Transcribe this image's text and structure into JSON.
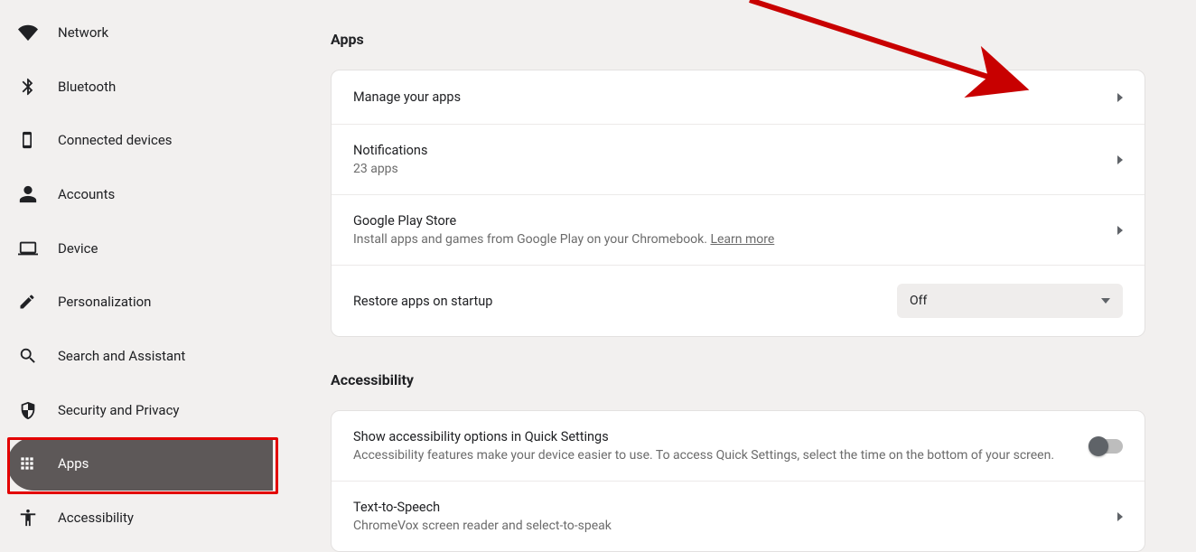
{
  "sidebar": {
    "items": [
      {
        "label": "Network"
      },
      {
        "label": "Bluetooth"
      },
      {
        "label": "Connected devices"
      },
      {
        "label": "Accounts"
      },
      {
        "label": "Device"
      },
      {
        "label": "Personalization"
      },
      {
        "label": "Search and Assistant"
      },
      {
        "label": "Security and Privacy"
      },
      {
        "label": "Apps"
      },
      {
        "label": "Accessibility"
      }
    ]
  },
  "sections": {
    "apps": {
      "title": "Apps",
      "rows": {
        "manage": {
          "title": "Manage your apps"
        },
        "notifications": {
          "title": "Notifications",
          "subtitle": "23 apps"
        },
        "play": {
          "title": "Google Play Store",
          "subtitle_prefix": "Install apps and games from Google Play on your Chromebook. ",
          "learn_more": "Learn more"
        },
        "restore": {
          "title": "Restore apps on startup",
          "dropdown_value": "Off"
        }
      }
    },
    "accessibility": {
      "title": "Accessibility",
      "rows": {
        "quick": {
          "title": "Show accessibility options in Quick Settings",
          "subtitle": "Accessibility features make your device easier to use. To access Quick Settings, select the time on the bottom of your screen."
        },
        "tts": {
          "title": "Text-to-Speech",
          "subtitle": "ChromeVox screen reader and select-to-speak"
        }
      }
    }
  }
}
